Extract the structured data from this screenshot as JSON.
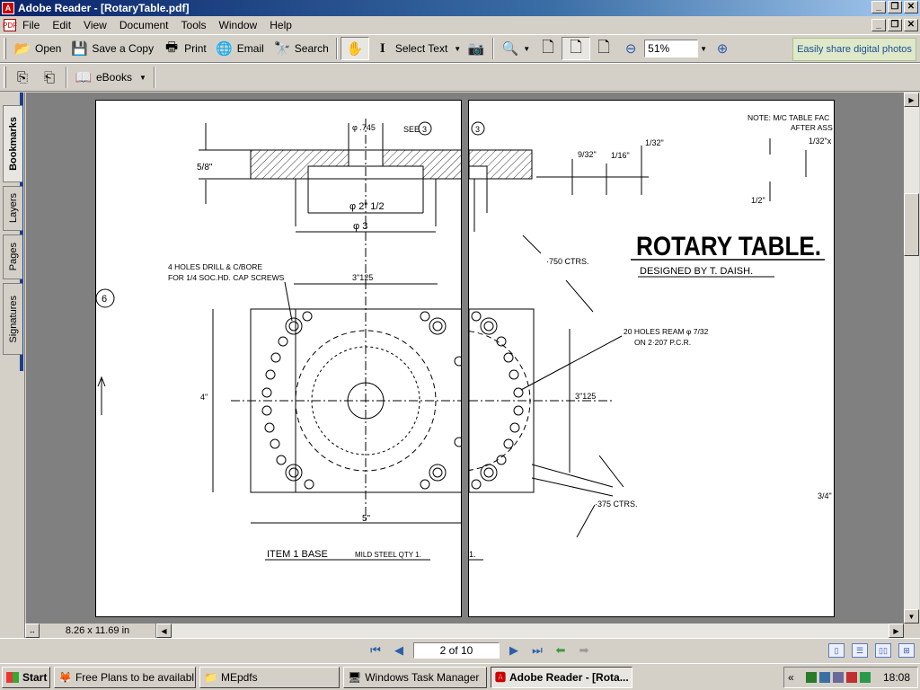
{
  "window": {
    "title": "Adobe Reader - [RotaryTable.pdf]",
    "controls": [
      "_",
      "❐",
      "✕"
    ]
  },
  "menu": [
    "File",
    "Edit",
    "View",
    "Document",
    "Tools",
    "Window",
    "Help"
  ],
  "toolbar": {
    "open": "Open",
    "save_copy": "Save a Copy",
    "print": "Print",
    "email": "Email",
    "search": "Search",
    "select_text": "Select Text",
    "zoom": "51%",
    "ad": "Easily share digital photos"
  },
  "toolbar2": {
    "ebooks": "eBooks"
  },
  "nav_tabs": [
    "Bookmarks",
    "Layers",
    "Pages",
    "Signatures"
  ],
  "drawing": {
    "page1": {
      "dim_745": "φ .745",
      "see": "SEE",
      "see_num": "3",
      "dim_58": "5/8\"",
      "dim_2half": "φ 2\" 1/2",
      "dim_3": "φ 3",
      "holes_note_1": "4 HOLES DRILL & C/BORE",
      "holes_note_2": "FOR 1/4 SOC.HD. CAP SCREWS",
      "dim_3125": "3\"125",
      "circle_label": "6",
      "dim_4": "4\"",
      "dim_5": "5\"",
      "item_title": "ITEM 1   BASE",
      "item_sub": "MILD STEEL  QTY 1."
    },
    "page2": {
      "see_num": "3",
      "note_1": "NOTE: M/C TABLE FAC",
      "note_2": "AFTER ASS",
      "dim_932": "9/32\"",
      "dim_116": "1/16\"",
      "dim_132": "1/32\"",
      "dim_132x": "1/32\"x",
      "dim_12": "1/2\"",
      "title": "ROTARY TABLE.",
      "designer": "DESIGNED BY  T. DAISH.",
      "ctrs_750": "·750 CTRS.",
      "holes_1": "20 HOLES REAM φ 7/32",
      "holes_2": "ON 2·207 P.C.R.",
      "dim_3125b": "3\"125",
      "ctrs_375": "·375 CTRS.",
      "dim_34": "3/4\"",
      "item_frag": "1."
    }
  },
  "status": {
    "page_size": "8.26 x 11.69 in",
    "page_indicator": "2 of 10"
  },
  "taskbar": {
    "start": "Start",
    "tasks": [
      "Free Plans to be availabl...",
      "MEpdfs",
      "Windows Task Manager",
      "Adobe Reader - [Rota..."
    ],
    "clock": "18:08",
    "tray_arrow": "«"
  }
}
